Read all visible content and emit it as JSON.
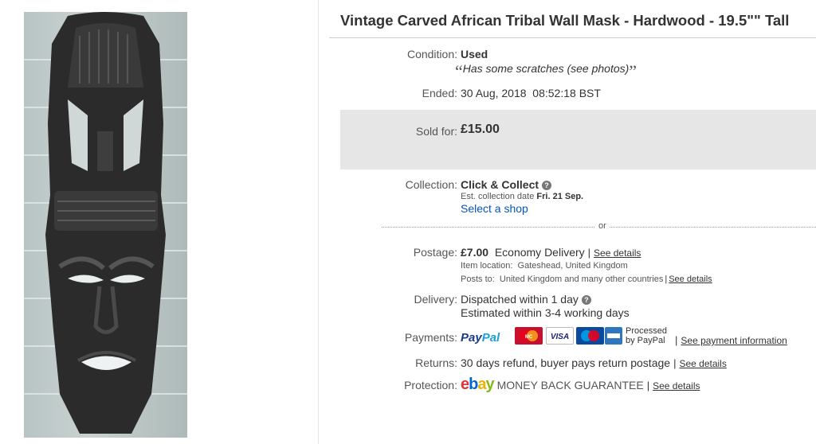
{
  "listing": {
    "title": "Vintage Carved African Tribal Wall Mask - Hardwood - 19.5\"\" Tall"
  },
  "condition": {
    "label": "Condition:",
    "value": "Used",
    "open_quote": "“",
    "note": "Has some scratches (see photos)",
    "close_quote": "”"
  },
  "ended": {
    "label": "Ended:",
    "value": "30 Aug, 2018  08:52:18 BST"
  },
  "sold": {
    "label": "Sold for:",
    "price": "£15.00"
  },
  "collection": {
    "label": "Collection:",
    "value": "Click & Collect",
    "help_icon": "?",
    "est_prefix": "Est. collection date",
    "est_date": "Fri. 21 Sep.",
    "link": "Select a shop"
  },
  "or_text": "or",
  "postage": {
    "label": "Postage:",
    "price": "£7.00",
    "service": "Economy Delivery",
    "sep": "|",
    "details_link": "See details",
    "item_location": "Item location:  Gateshead, United Kingdom",
    "posts_to": "Posts to:  United Kingdom and many other countries",
    "posts_sep": "|",
    "posts_link": "See details"
  },
  "delivery": {
    "label": "Delivery:",
    "dispatch": "Dispatched within 1 day",
    "help_icon": "?",
    "estimate": "Estimated within 3-4 working days"
  },
  "payments": {
    "label": "Payments:",
    "paypal_pay": "Pay",
    "paypal_pal": "Pal",
    "cards": [
      {
        "name": "mastercard-icon",
        "text": "MasterCard"
      },
      {
        "name": "visa-icon",
        "text": "VISA"
      },
      {
        "name": "maestro-icon",
        "text": "Maestro"
      },
      {
        "name": "amex-icon",
        "text": "AMEX"
      }
    ],
    "processed_line1": "Processed",
    "processed_line2": "by PayPal",
    "sep": "|",
    "link": "See payment information"
  },
  "returns": {
    "label": "Returns:",
    "value": "30 days refund, buyer pays return postage",
    "sep": "|",
    "link": "See details"
  },
  "protection": {
    "label": "Protection:",
    "ebay_e": "e",
    "ebay_b": "b",
    "ebay_a": "a",
    "ebay_y": "y",
    "guarantee": "MONEY BACK GUARANTEE",
    "sep": "|",
    "link": "See details"
  },
  "colors": {
    "link_blue": "#0654ba",
    "sold_box_bg": "#e6e6e6",
    "ebay_red": "#e53238",
    "ebay_blue": "#0064d2",
    "ebay_yellow": "#f5af02",
    "ebay_green": "#86b817"
  }
}
